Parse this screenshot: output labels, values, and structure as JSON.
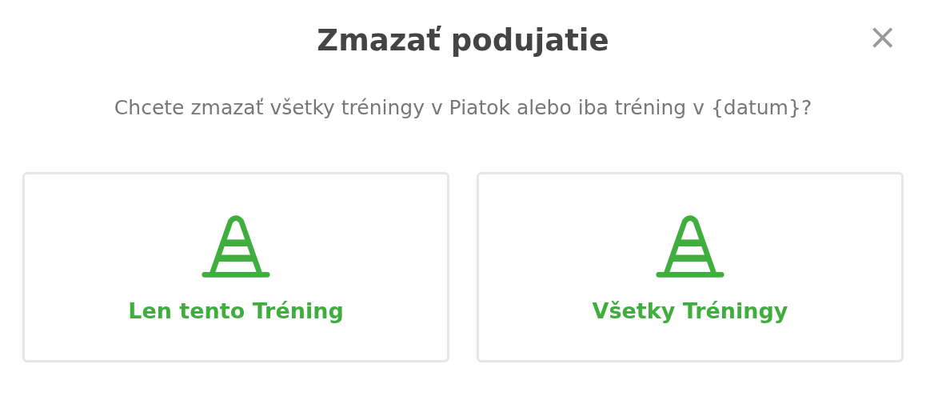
{
  "dialog": {
    "title": "Zmazať podujatie",
    "close": "×",
    "message": "Chcete zmazať všetky tréningy v Piatok alebo iba tréning v {datum}?"
  },
  "options": [
    {
      "label": "Len tento Tréning"
    },
    {
      "label": "Všetky Tréningy"
    }
  ]
}
